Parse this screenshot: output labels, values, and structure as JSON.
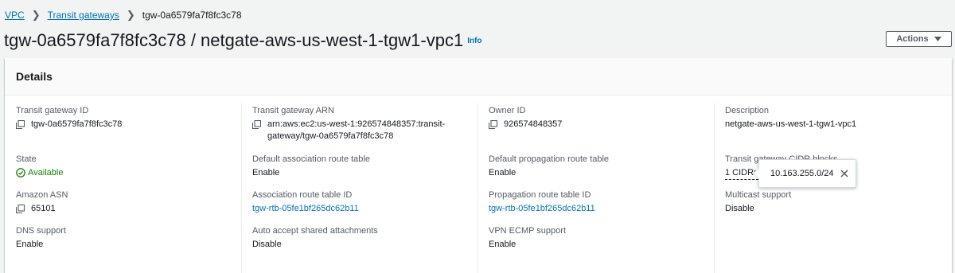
{
  "breadcrumb": {
    "vpc": "VPC",
    "transit_gateways": "Transit gateways",
    "current": "tgw-0a6579fa7f8fc3c78"
  },
  "header": {
    "title": "tgw-0a6579fa7f8fc3c78 / netgate-aws-us-west-1-tgw1-vpc1",
    "info": "Info",
    "actions": "Actions"
  },
  "details": {
    "title": "Details",
    "transit_gateway_id": {
      "label": "Transit gateway ID",
      "value": "tgw-0a6579fa7f8fc3c78"
    },
    "transit_gateway_arn": {
      "label": "Transit gateway ARN",
      "line1": "arn:aws:ec2:us-west-1:926574848357:transit-",
      "line2": "gateway/tgw-0a6579fa7f8fc3c78"
    },
    "owner_id": {
      "label": "Owner ID",
      "value": "926574848357"
    },
    "description": {
      "label": "Description",
      "value": "netgate-aws-us-west-1-tgw1-vpc1"
    },
    "state": {
      "label": "State",
      "value": "Available"
    },
    "default_association_route_table": {
      "label": "Default association route table",
      "value": "Enable"
    },
    "default_propagation_route_table": {
      "label": "Default propagation route table",
      "value": "Enable"
    },
    "cidr_blocks": {
      "label": "Transit gateway CIDR blocks",
      "value": "1 CIDRs"
    },
    "amazon_asn": {
      "label": "Amazon ASN",
      "value": "65101"
    },
    "association_route_table_id": {
      "label": "Association route table ID",
      "value": "tgw-rtb-05fe1bf265dc62b11"
    },
    "propagation_route_table_id": {
      "label": "Propagation route table ID",
      "value": "tgw-rtb-05fe1bf265dc62b11"
    },
    "multicast_support": {
      "label": "Multicast support",
      "value": "Disable"
    },
    "dns_support": {
      "label": "DNS support",
      "value": "Enable"
    },
    "auto_accept_shared_attachments": {
      "label": "Auto accept shared attachments",
      "value": "Disable"
    },
    "vpn_ecmp_support": {
      "label": "VPN ECMP support",
      "value": "Enable"
    }
  },
  "popover": {
    "cidr": "10.163.255.0/24"
  },
  "icons": {
    "copy": "copy-icon",
    "status": "status-available-icon",
    "close": "close-icon",
    "caret": "caret-down-icon",
    "chevron": "chevron-right-icon"
  },
  "colors": {
    "link": "#0073bb",
    "success": "#1d8102",
    "text": "#16191f",
    "secondary": "#545b64",
    "background": "#f2f3f3"
  }
}
